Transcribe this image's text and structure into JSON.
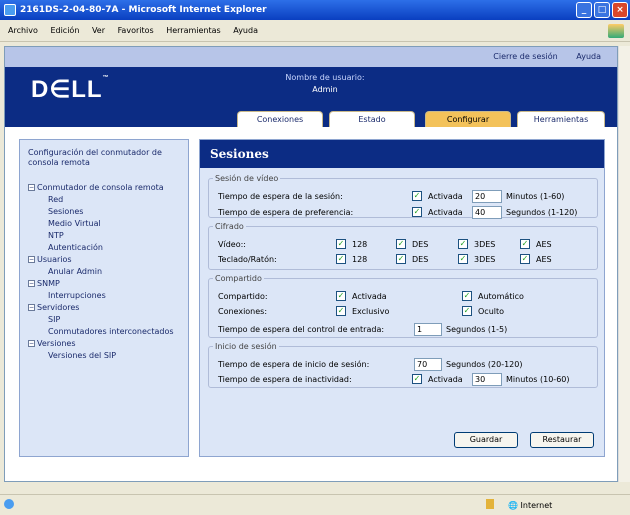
{
  "window": {
    "title": "2161DS-2-04-80-7A - Microsoft Internet Explorer"
  },
  "menu": [
    "Archivo",
    "Edición",
    "Ver",
    "Favoritos",
    "Herramientas",
    "Ayuda"
  ],
  "header": {
    "logout": "Cierre de sesión",
    "help": "Ayuda",
    "logo": "D∈LL",
    "user_label": "Nombre de usuario:",
    "user_name": "Admin"
  },
  "tabs": [
    "Conexiones",
    "Estado",
    "Configurar",
    "Herramientas"
  ],
  "active_tab": "Configurar",
  "sidebar": {
    "title": "Configuración del conmutador de consola remota",
    "items": [
      {
        "label": "Conmutador de consola remota",
        "level": 0,
        "box": "−"
      },
      {
        "label": "Red",
        "level": 1
      },
      {
        "label": "Sesiones",
        "level": 1
      },
      {
        "label": "Medio Virtual",
        "level": 1
      },
      {
        "label": "NTP",
        "level": 1
      },
      {
        "label": "Autenticación",
        "level": 1
      },
      {
        "label": "Usuarios",
        "level": 0,
        "box": "−"
      },
      {
        "label": "Anular Admin",
        "level": 1
      },
      {
        "label": "SNMP",
        "level": 0,
        "box": "−"
      },
      {
        "label": "Interrupciones",
        "level": 1
      },
      {
        "label": "Servidores",
        "level": 0,
        "box": "−"
      },
      {
        "label": "SIP",
        "level": 1
      },
      {
        "label": "Conmutadores interconectados",
        "level": 1
      },
      {
        "label": "Versiones",
        "level": 0,
        "box": "−"
      },
      {
        "label": "Versiones del SIP",
        "level": 1
      }
    ]
  },
  "main": {
    "title": "Sesiones",
    "video": {
      "legend": "Sesión de vídeo",
      "timeout_label": "Tiempo de espera de la sesión:",
      "timeout_enabled": "Activada",
      "timeout_value": "20",
      "timeout_unit": "Minutos (1-60)",
      "pref_label": "Tiempo de espera de preferencia:",
      "pref_enabled": "Activada",
      "pref_value": "40",
      "pref_unit": "Segundos (1-120)"
    },
    "cipher": {
      "legend": "Cifrado",
      "video_label": "Vídeo::",
      "kbd_label": "Teclado/Ratón:",
      "options": [
        "128",
        "DES",
        "3DES",
        "AES"
      ]
    },
    "sharing": {
      "legend": "Compartido",
      "shared_label": "Compartido:",
      "shared_enabled": "Activada",
      "shared_auto": "Automático",
      "conn_label": "Conexiones:",
      "conn_exclusive": "Exclusivo",
      "conn_hidden": "Oculto",
      "input_label": "Tiempo de espera del control de entrada:",
      "input_value": "1",
      "input_unit": "Segundos (1-5)"
    },
    "login": {
      "legend": "Inicio de sesión",
      "login_label": "Tiempo de espera de inicio de sesión:",
      "login_value": "70",
      "login_unit": "Segundos (20-120)",
      "idle_label": "Tiempo de espera de inactividad:",
      "idle_enabled": "Activada",
      "idle_value": "30",
      "idle_unit": "Minutos (10-60)"
    },
    "save": "Guardar",
    "restore": "Restaurar"
  },
  "status": {
    "zone": "Internet"
  }
}
